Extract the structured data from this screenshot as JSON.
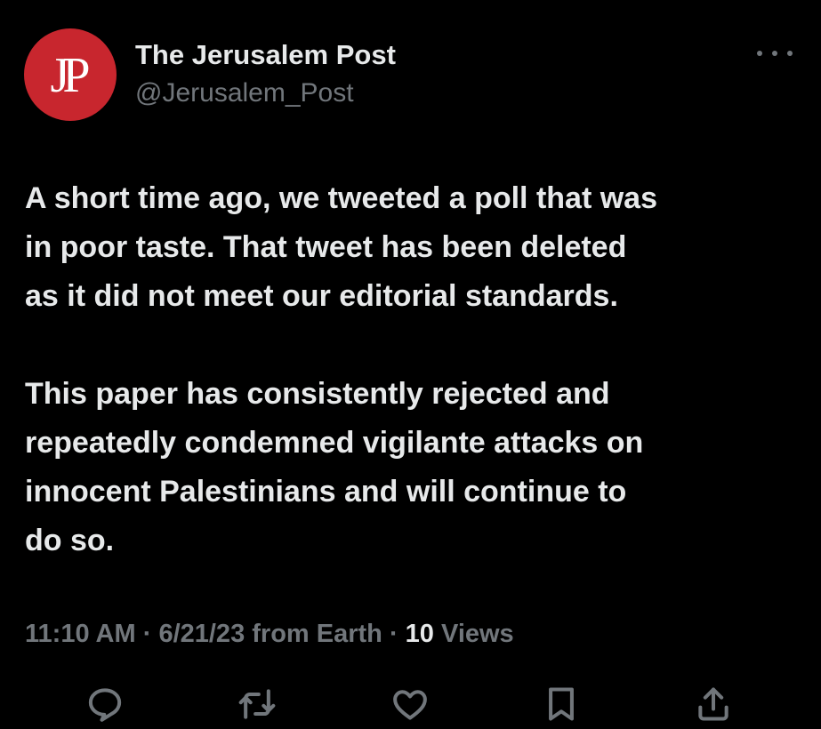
{
  "account": {
    "avatar_text": "JP",
    "name": "The Jerusalem Post",
    "handle": "@Jerusalem_Post"
  },
  "tweet": {
    "paragraphs": [
      "A short time ago, we tweeted a poll that was\nin poor taste. That tweet has been deleted\nas it did not meet our editorial standards.",
      "This paper has consistently rejected and\nrepeatedly condemned vigilante attacks on\ninnocent Palestinians and will continue to\ndo so."
    ]
  },
  "meta": {
    "time": "11:10 AM",
    "sep1": " · ",
    "date": "6/21/23",
    "source": " from Earth",
    "sep2": " · ",
    "views_count": "10",
    "views_label": " Views"
  },
  "actions": [
    {
      "name": "reply-icon"
    },
    {
      "name": "retweet-icon"
    },
    {
      "name": "like-icon"
    },
    {
      "name": "bookmark-icon"
    },
    {
      "name": "share-icon"
    }
  ],
  "colors": {
    "background": "#000000",
    "text": "#e7e9ea",
    "secondary": "#71767b",
    "avatar": "#c8262e"
  }
}
